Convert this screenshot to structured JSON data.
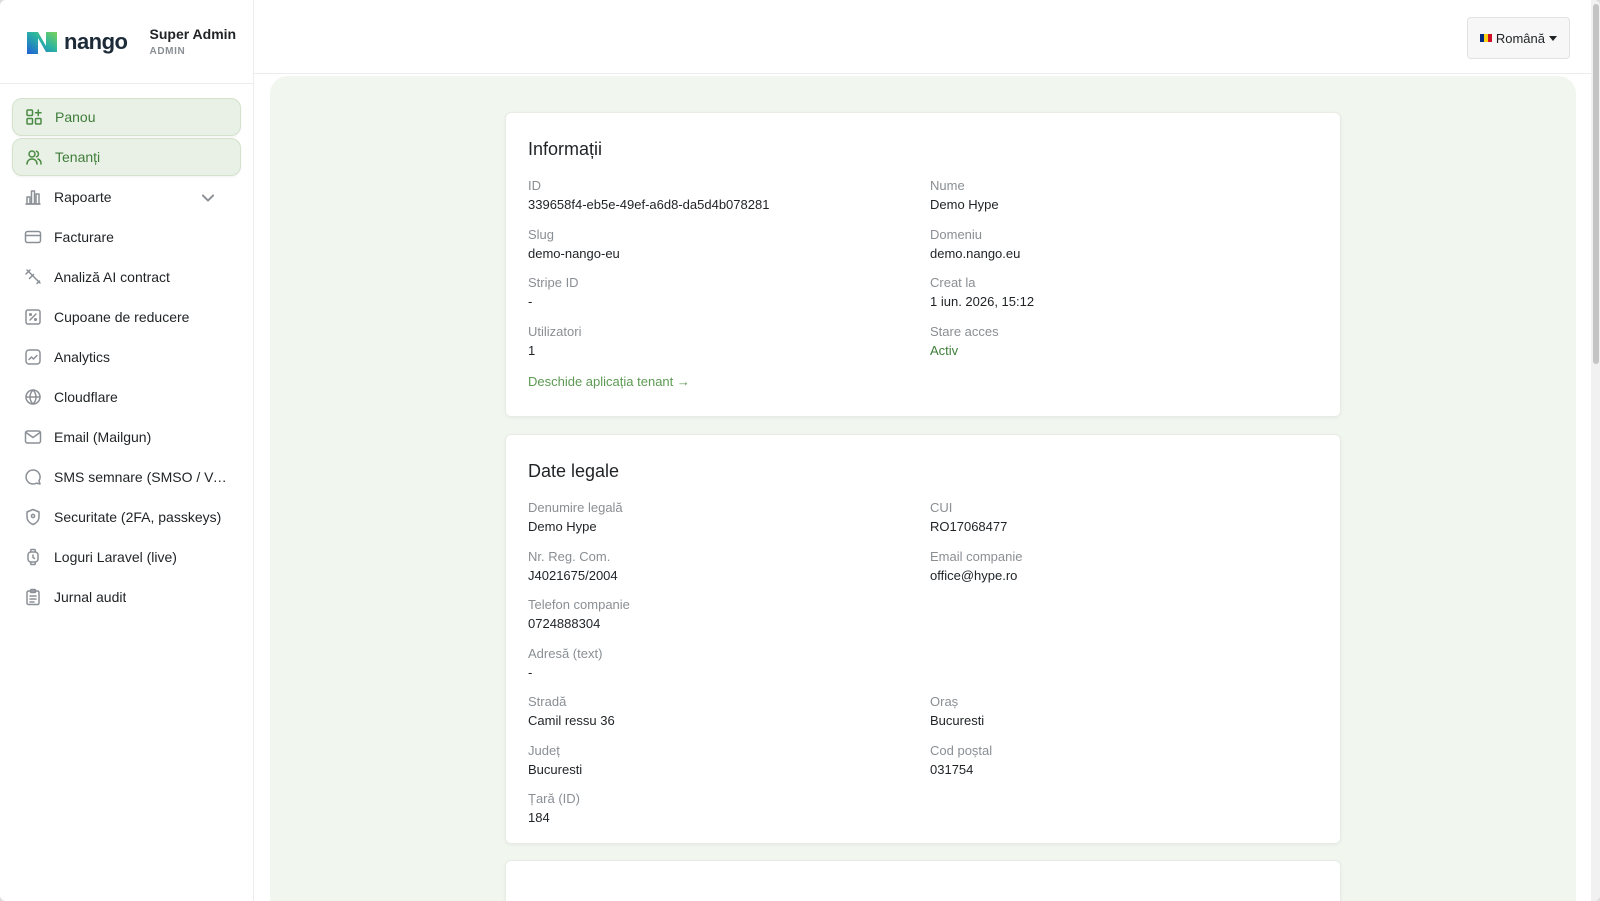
{
  "brand": {
    "name": "nango"
  },
  "user": {
    "name": "Super Admin",
    "role": "ADMIN"
  },
  "sidebar": {
    "items": [
      {
        "label": "Panou",
        "icon": "dashboard-icon"
      },
      {
        "label": "Tenanți",
        "icon": "users-icon"
      },
      {
        "label": "Rapoarte",
        "icon": "bar-chart-icon"
      },
      {
        "label": "Facturare",
        "icon": "credit-card-icon"
      },
      {
        "label": "Analiză AI contract",
        "icon": "magic-pen-icon"
      },
      {
        "label": "Cupoane de reducere",
        "icon": "coupon-icon"
      },
      {
        "label": "Analytics",
        "icon": "trend-icon"
      },
      {
        "label": "Cloudflare",
        "icon": "globe-icon"
      },
      {
        "label": "Email (Mailgun)",
        "icon": "mail-icon"
      },
      {
        "label": "SMS semnare (SMSO / Von...",
        "icon": "chat-icon"
      },
      {
        "label": "Securitate (2FA, passkeys)",
        "icon": "shield-icon"
      },
      {
        "label": "Loguri Laravel (live)",
        "icon": "watch-icon"
      },
      {
        "label": "Jurnal audit",
        "icon": "clipboard-icon"
      }
    ]
  },
  "topbar": {
    "language": "Română"
  },
  "info_card": {
    "title": "Informații",
    "fields": {
      "id": {
        "label": "ID",
        "value": "339658f4-eb5e-49ef-a6d8-da5d4b078281"
      },
      "name": {
        "label": "Nume",
        "value": "Demo Hype"
      },
      "slug": {
        "label": "Slug",
        "value": "demo-nango-eu"
      },
      "domain": {
        "label": "Domeniu",
        "value": "demo.nango.eu"
      },
      "stripe": {
        "label": "Stripe ID",
        "value": "-"
      },
      "created": {
        "label": "Creat la",
        "value": "1 iun. 2026, 15:12"
      },
      "users": {
        "label": "Utilizatori",
        "value": "1"
      },
      "access": {
        "label": "Stare acces",
        "value": "Activ"
      }
    },
    "link": "Deschide aplicația tenant →"
  },
  "legal_card": {
    "title": "Date legale",
    "fields": {
      "legal_name": {
        "label": "Denumire legală",
        "value": "Demo Hype"
      },
      "cui": {
        "label": "CUI",
        "value": "RO17068477"
      },
      "reg_com": {
        "label": "Nr. Reg. Com.",
        "value": "J4021675/2004"
      },
      "company_email": {
        "label": "Email companie",
        "value": "office@hype.ro"
      },
      "company_phone": {
        "label": "Telefon companie",
        "value": "0724888304"
      },
      "address_text": {
        "label": "Adresă (text)",
        "value": "-"
      },
      "street": {
        "label": "Stradă",
        "value": "Camil ressu 36"
      },
      "city": {
        "label": "Oraș",
        "value": "Bucuresti"
      },
      "county": {
        "label": "Județ",
        "value": "Bucuresti"
      },
      "postal_code": {
        "label": "Cod poștal",
        "value": "031754"
      },
      "country_id": {
        "label": "Țară (ID)",
        "value": "184"
      }
    }
  },
  "colors": {
    "accent": "#3f7d3a",
    "active_bg": "#e9f1e6",
    "main_bg": "#f1f6ef"
  }
}
